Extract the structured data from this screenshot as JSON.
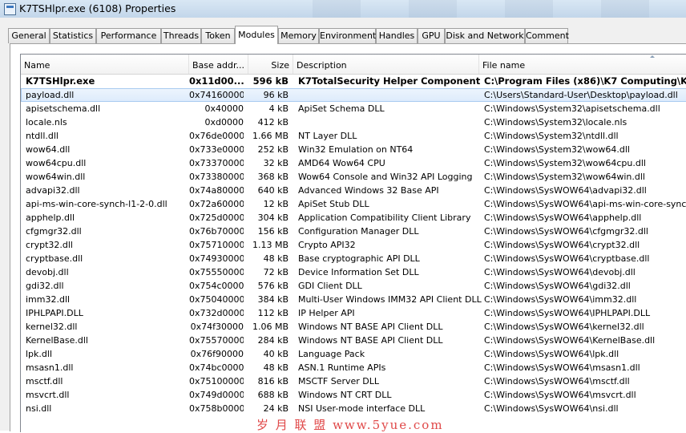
{
  "window": {
    "title": "K7TSHlpr.exe (6108) Properties"
  },
  "tabs": [
    {
      "label": "General",
      "active": false
    },
    {
      "label": "Statistics",
      "active": false
    },
    {
      "label": "Performance",
      "active": false
    },
    {
      "label": "Threads",
      "active": false
    },
    {
      "label": "Token",
      "active": false
    },
    {
      "label": "Modules",
      "active": true
    },
    {
      "label": "Memory",
      "active": false
    },
    {
      "label": "Environment",
      "active": false
    },
    {
      "label": "Handles",
      "active": false
    },
    {
      "label": "GPU",
      "active": false
    },
    {
      "label": "Disk and Network",
      "active": false
    },
    {
      "label": "Comment",
      "active": false
    }
  ],
  "columns": {
    "name": "Name",
    "base": "Base addr...",
    "size": "Size",
    "desc": "Description",
    "file": "File name"
  },
  "sort": {
    "column": "File name",
    "icon": "sort-arrow-icon"
  },
  "rows": [
    {
      "name": "K7TSHlpr.exe",
      "base": "0x11d00...",
      "size": "596 kB",
      "desc": "K7TotalSecurity Helper Component",
      "file": "C:\\Program Files (x86)\\K7 Computing\\K7TSec"
    },
    {
      "name": "payload.dll",
      "base": "0x74160000",
      "size": "96 kB",
      "desc": "",
      "file": "C:\\Users\\Standard-User\\Desktop\\payload.dll"
    },
    {
      "name": "apisetschema.dll",
      "base": "0x40000",
      "size": "4 kB",
      "desc": "ApiSet Schema DLL",
      "file": "C:\\Windows\\System32\\apisetschema.dll"
    },
    {
      "name": "locale.nls",
      "base": "0xd0000",
      "size": "412 kB",
      "desc": "",
      "file": "C:\\Windows\\System32\\locale.nls"
    },
    {
      "name": "ntdll.dll",
      "base": "0x76de0000",
      "size": "1.66 MB",
      "desc": "NT Layer DLL",
      "file": "C:\\Windows\\System32\\ntdll.dll"
    },
    {
      "name": "wow64.dll",
      "base": "0x733e0000",
      "size": "252 kB",
      "desc": "Win32 Emulation on NT64",
      "file": "C:\\Windows\\System32\\wow64.dll"
    },
    {
      "name": "wow64cpu.dll",
      "base": "0x73370000",
      "size": "32 kB",
      "desc": "AMD64 Wow64 CPU",
      "file": "C:\\Windows\\System32\\wow64cpu.dll"
    },
    {
      "name": "wow64win.dll",
      "base": "0x73380000",
      "size": "368 kB",
      "desc": "Wow64 Console and Win32 API Logging",
      "file": "C:\\Windows\\System32\\wow64win.dll"
    },
    {
      "name": "advapi32.dll",
      "base": "0x74a80000",
      "size": "640 kB",
      "desc": "Advanced Windows 32 Base API",
      "file": "C:\\Windows\\SysWOW64\\advapi32.dll"
    },
    {
      "name": "api-ms-win-core-synch-l1-2-0.dll",
      "base": "0x72a60000",
      "size": "12 kB",
      "desc": "ApiSet Stub DLL",
      "file": "C:\\Windows\\SysWOW64\\api-ms-win-core-synch-l1-2"
    },
    {
      "name": "apphelp.dll",
      "base": "0x725d0000",
      "size": "304 kB",
      "desc": "Application Compatibility Client Library",
      "file": "C:\\Windows\\SysWOW64\\apphelp.dll"
    },
    {
      "name": "cfgmgr32.dll",
      "base": "0x76b70000",
      "size": "156 kB",
      "desc": "Configuration Manager DLL",
      "file": "C:\\Windows\\SysWOW64\\cfgmgr32.dll"
    },
    {
      "name": "crypt32.dll",
      "base": "0x75710000",
      "size": "1.13 MB",
      "desc": "Crypto API32",
      "file": "C:\\Windows\\SysWOW64\\crypt32.dll"
    },
    {
      "name": "cryptbase.dll",
      "base": "0x74930000",
      "size": "48 kB",
      "desc": "Base cryptographic API DLL",
      "file": "C:\\Windows\\SysWOW64\\cryptbase.dll"
    },
    {
      "name": "devobj.dll",
      "base": "0x75550000",
      "size": "72 kB",
      "desc": "Device Information Set DLL",
      "file": "C:\\Windows\\SysWOW64\\devobj.dll"
    },
    {
      "name": "gdi32.dll",
      "base": "0x754c0000",
      "size": "576 kB",
      "desc": "GDI Client DLL",
      "file": "C:\\Windows\\SysWOW64\\gdi32.dll"
    },
    {
      "name": "imm32.dll",
      "base": "0x75040000",
      "size": "384 kB",
      "desc": "Multi-User Windows IMM32 API Client DLL",
      "file": "C:\\Windows\\SysWOW64\\imm32.dll"
    },
    {
      "name": "IPHLPAPI.DLL",
      "base": "0x732d0000",
      "size": "112 kB",
      "desc": "IP Helper API",
      "file": "C:\\Windows\\SysWOW64\\IPHLPAPI.DLL"
    },
    {
      "name": "kernel32.dll",
      "base": "0x74f30000",
      "size": "1.06 MB",
      "desc": "Windows NT BASE API Client DLL",
      "file": "C:\\Windows\\SysWOW64\\kernel32.dll"
    },
    {
      "name": "KernelBase.dll",
      "base": "0x75570000",
      "size": "284 kB",
      "desc": "Windows NT BASE API Client DLL",
      "file": "C:\\Windows\\SysWOW64\\KernelBase.dll"
    },
    {
      "name": "lpk.dll",
      "base": "0x76f90000",
      "size": "40 kB",
      "desc": "Language Pack",
      "file": "C:\\Windows\\SysWOW64\\lpk.dll"
    },
    {
      "name": "msasn1.dll",
      "base": "0x74bc0000",
      "size": "48 kB",
      "desc": "ASN.1 Runtime APIs",
      "file": "C:\\Windows\\SysWOW64\\msasn1.dll"
    },
    {
      "name": "msctf.dll",
      "base": "0x75100000",
      "size": "816 kB",
      "desc": "MSCTF Server DLL",
      "file": "C:\\Windows\\SysWOW64\\msctf.dll"
    },
    {
      "name": "msvcrt.dll",
      "base": "0x749d0000",
      "size": "688 kB",
      "desc": "Windows NT CRT DLL",
      "file": "C:\\Windows\\SysWOW64\\msvcrt.dll"
    },
    {
      "name": "nsi.dll",
      "base": "0x758b0000",
      "size": "24 kB",
      "desc": "NSI User-mode interface DLL",
      "file": "C:\\Windows\\SysWOW64\\nsi.dll"
    }
  ],
  "watermark": "岁 月 联 盟   www.5yue.com",
  "colors": {
    "selected_row": "#dcebfc",
    "watermark": "#e04848",
    "titlebar": "#c2d6ea"
  }
}
